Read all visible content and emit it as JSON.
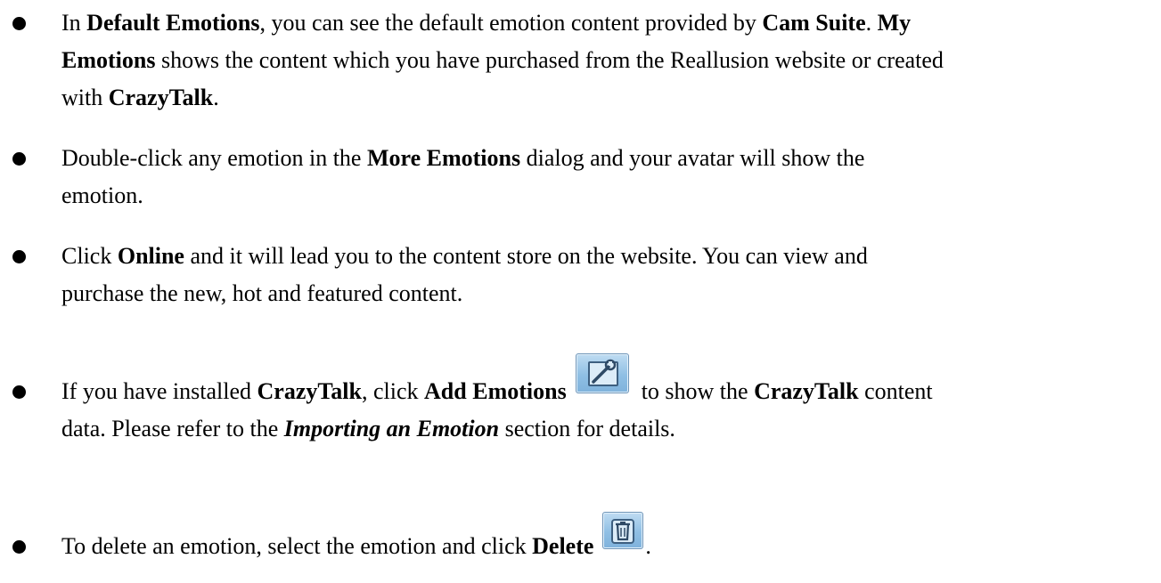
{
  "bullets": [
    {
      "p1": "In ",
      "b1": "Default Emotions",
      "p2": ", you can see the default emotion content provided by ",
      "b2": "Cam Suite",
      "p3": ". ",
      "b3": "My",
      "b4": "Emotions",
      "p4": " shows the content which you have purchased from the Reallusion website or created",
      "p5": "with ",
      "b5": "CrazyTalk",
      "p6": "."
    },
    {
      "p1": "Double-click any emotion in the ",
      "b1": "More Emotions",
      "p2": " dialog and your avatar will show the",
      "p3": "emotion."
    },
    {
      "p1": "Click ",
      "b1": "Online",
      "p2": " and it will lead you to the content store on the website. You can view and",
      "p3": "purchase the new, hot and featured content."
    },
    {
      "p1": "If you have installed ",
      "b1": "CrazyTalk",
      "p2": ", click ",
      "b2": "Add Emotions",
      "icon": "add-emotions-wrench-icon",
      "p3": "to show the ",
      "b3": "CrazyTalk",
      "p4": " content",
      "p5": "data. Please refer to the ",
      "bi1": "Importing an Emotion",
      "p6": " section for details."
    },
    {
      "p1": "To delete an emotion, select the emotion and click ",
      "b1": "Delete",
      "icon": "delete-trash-icon",
      "p2": "."
    }
  ]
}
